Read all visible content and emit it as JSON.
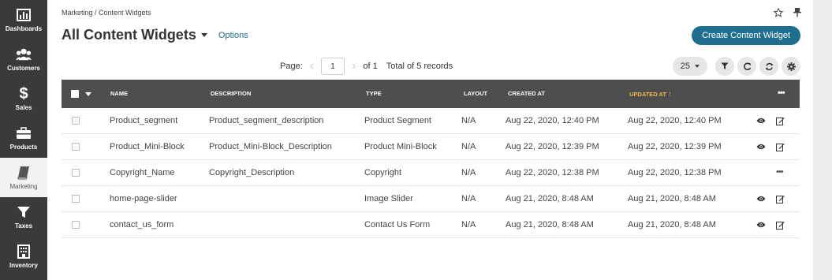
{
  "sidebar": {
    "items": [
      {
        "label": "Dashboards",
        "icon": "chart-icon",
        "active": false
      },
      {
        "label": "Customers",
        "icon": "users-icon",
        "active": false
      },
      {
        "label": "Sales",
        "icon": "dollar-icon",
        "active": false
      },
      {
        "label": "Products",
        "icon": "briefcase-icon",
        "active": false
      },
      {
        "label": "Marketing",
        "icon": "book-icon",
        "active": true
      },
      {
        "label": "Taxes",
        "icon": "funnel-icon",
        "active": false
      },
      {
        "label": "Inventory",
        "icon": "building-icon",
        "active": false
      }
    ]
  },
  "header": {
    "breadcrumb": "Marketing / Content Widgets",
    "title": "All Content Widgets",
    "options_label": "Options",
    "create_button": "Create Content Widget"
  },
  "pager": {
    "page_label": "Page:",
    "current_page": "1",
    "of_label": "of 1",
    "total_label": "Total of 5 records",
    "page_size": "25"
  },
  "table": {
    "columns": [
      "NAME",
      "DESCRIPTION",
      "TYPE",
      "LAYOUT",
      "CREATED AT",
      "UPDATED AT"
    ],
    "sorted_column": "UPDATED AT",
    "rows": [
      {
        "name": "Product_segment",
        "description": "Product_segment_description",
        "type": "Product Segment",
        "layout": "N/A",
        "created": "Aug 22, 2020, 12:40 PM",
        "updated": "Aug 22, 2020, 12:40 PM",
        "actions": "view-edit"
      },
      {
        "name": "Product_Mini-Block",
        "description": "Product_Mini-Block_Description",
        "type": "Product Mini-Block",
        "layout": "N/A",
        "created": "Aug 22, 2020, 12:39 PM",
        "updated": "Aug 22, 2020, 12:39 PM",
        "actions": "view-edit"
      },
      {
        "name": "Copyright_Name",
        "description": "Copyright_Description",
        "type": "Copyright",
        "layout": "N/A",
        "created": "Aug 22, 2020, 12:38 PM",
        "updated": "Aug 22, 2020, 12:38 PM",
        "actions": "more"
      },
      {
        "name": "home-page-slider",
        "description": "",
        "type": "Image Slider",
        "layout": "N/A",
        "created": "Aug 21, 2020, 8:48 AM",
        "updated": "Aug 21, 2020, 8:48 AM",
        "actions": "view-edit"
      },
      {
        "name": "contact_us_form",
        "description": "",
        "type": "Contact Us Form",
        "layout": "N/A",
        "created": "Aug 21, 2020, 8:48 AM",
        "updated": "Aug 21, 2020, 8:48 AM",
        "actions": "view-edit"
      }
    ]
  },
  "colors": {
    "sidebar_bg": "#3a3a3a",
    "accent": "#1f6e8f",
    "table_header_bg": "#4e4e4e",
    "sorted_header": "#f0b84b"
  }
}
